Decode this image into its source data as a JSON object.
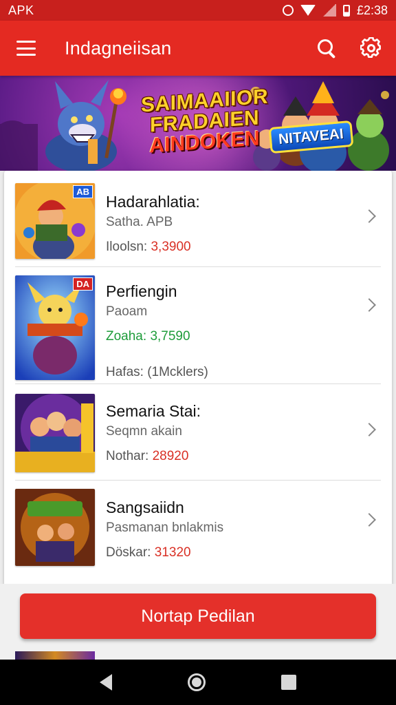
{
  "status_bar": {
    "carrier": "APK",
    "time": "£2:38"
  },
  "app_bar": {
    "title": "Indagneiisan"
  },
  "banner": {
    "line1": "SAIMAAIIOR",
    "line2": "FRADAIEN",
    "line3": "AINDOKEN",
    "badge": "NITAVEAI"
  },
  "items": [
    {
      "name": "Hadarahlatia:",
      "sub": "Satha. APB",
      "price_label": "Iloolsn:",
      "price_value": "3,3900",
      "badge": "AB",
      "badge_color": "#1d5bd8"
    },
    {
      "name": "Perfiengin",
      "sub": "Paoam",
      "price_label": "Zoaha:",
      "price_value": "3,7590",
      "extra": "Hafas: (1Mcklers)",
      "badge": "DA",
      "badge_color": "#d42222"
    },
    {
      "name": "Semaria Stai:",
      "sub": "Seqmn akain",
      "price_label": "Nothar:",
      "price_value": "28920"
    },
    {
      "name": "Sangsaiidn",
      "sub": "Pasmanan bnlakmis",
      "price_label": "Döskar:",
      "price_value": "31320"
    }
  ],
  "cta": {
    "label": "Nortap Pedilan"
  },
  "colors": {
    "primary": "#e42a22",
    "status_bar": "#c8201d",
    "price": "#d93025",
    "price_green": "#1e9c3a"
  },
  "icons": [
    "menu-icon",
    "search-icon",
    "gear-icon",
    "chevron-right-icon",
    "back-icon",
    "home-icon",
    "recents-icon"
  ]
}
